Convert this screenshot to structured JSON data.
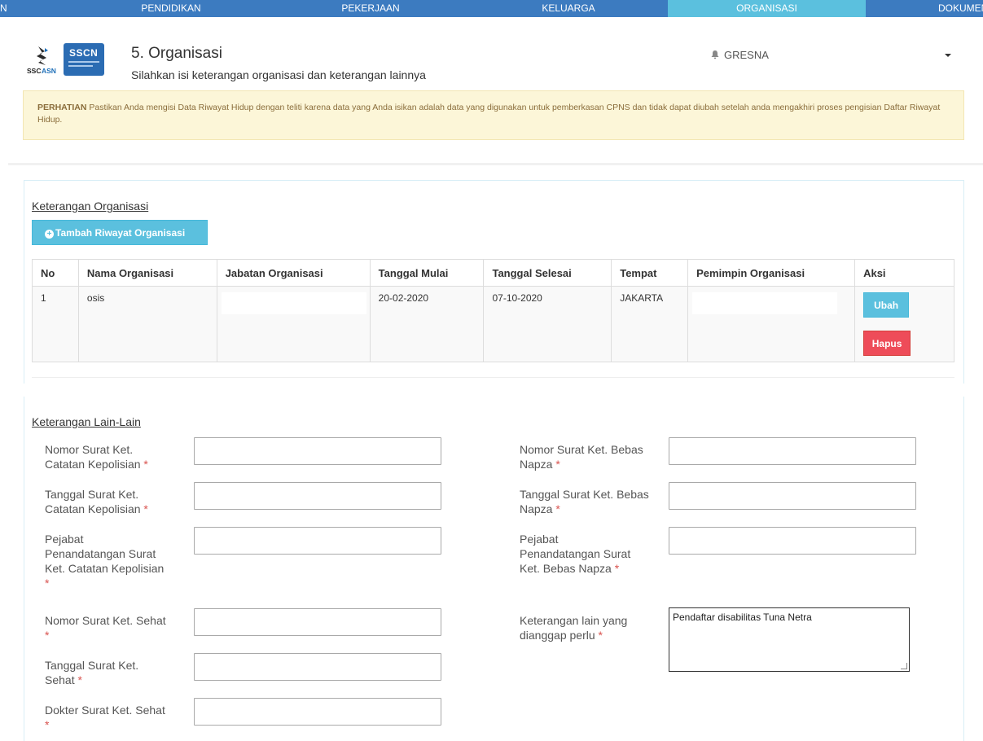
{
  "nav": {
    "tabs": [
      {
        "label": "N"
      },
      {
        "label": "PENDIDIKAN"
      },
      {
        "label": "PEKERJAAN"
      },
      {
        "label": "KELUARGA"
      },
      {
        "label": "ORGANISASI"
      },
      {
        "label": "DOKUMEN"
      }
    ],
    "active": "ORGANISASI",
    "colors": {
      "bar": "#3c7bc0",
      "active": "#5bc0de"
    }
  },
  "header": {
    "logo_left_text": "SSCASN",
    "logo_right_text": "SSCN",
    "title": "5. Organisasi",
    "subtitle": "Silahkan isi keterangan organisasi dan keterangan lainnya",
    "user_name": "GRESNA",
    "user_icon": "bell-icon"
  },
  "alert": {
    "strong": "PERHATIAN",
    "text": " Pastikan Anda mengisi Data Riwayat Hidup dengan teliti karena data yang Anda isikan adalah data yang digunakan untuk pemberkasan CPNS dan tidak dapat diubah setelah anda mengakhiri proses pengisian Daftar Riwayat Hidup."
  },
  "organisasi": {
    "section_title": "Keterangan Organisasi",
    "add_button": "Tambah Riwayat Organisasi",
    "columns": [
      "No",
      "Nama Organisasi",
      "Jabatan Organisasi",
      "Tanggal Mulai",
      "Tanggal Selesai",
      "Tempat",
      "Pemimpin Organisasi",
      "Aksi"
    ],
    "rows": [
      {
        "no": "1",
        "nama": "osis",
        "jabatan": "",
        "mulai": "20-02-2020",
        "selesai": "07-10-2020",
        "tempat": "JAKARTA",
        "pemimpin": "",
        "edit_label": "Ubah",
        "delete_label": "Hapus"
      }
    ]
  },
  "lain": {
    "section_title": "Keterangan Lain-Lain",
    "required_marker": "*",
    "left_fields": [
      {
        "label": "Nomor Surat Ket. Catatan Kepolisian",
        "value": ""
      },
      {
        "label": "Tanggal Surat Ket. Catatan Kepolisian",
        "value": ""
      },
      {
        "label": "Pejabat Penandatangan Surat Ket. Catatan Kepolisian",
        "value": ""
      },
      {
        "label": "Nomor Surat Ket. Sehat",
        "value": ""
      },
      {
        "label": "Tanggal Surat Ket. Sehat",
        "value": ""
      },
      {
        "label": "Dokter Surat Ket. Sehat",
        "value": ""
      }
    ],
    "right_fields": [
      {
        "label": "Nomor Surat Ket. Bebas Napza",
        "value": ""
      },
      {
        "label": "Tanggal Surat Ket. Bebas Napza",
        "value": ""
      },
      {
        "label": "Pejabat Penandatangan Surat Ket. Bebas Napza",
        "value": ""
      },
      {
        "label": "Keterangan lain yang dianggap perlu",
        "value": "Pendaftar disabilitas Tuna Netra"
      }
    ]
  }
}
